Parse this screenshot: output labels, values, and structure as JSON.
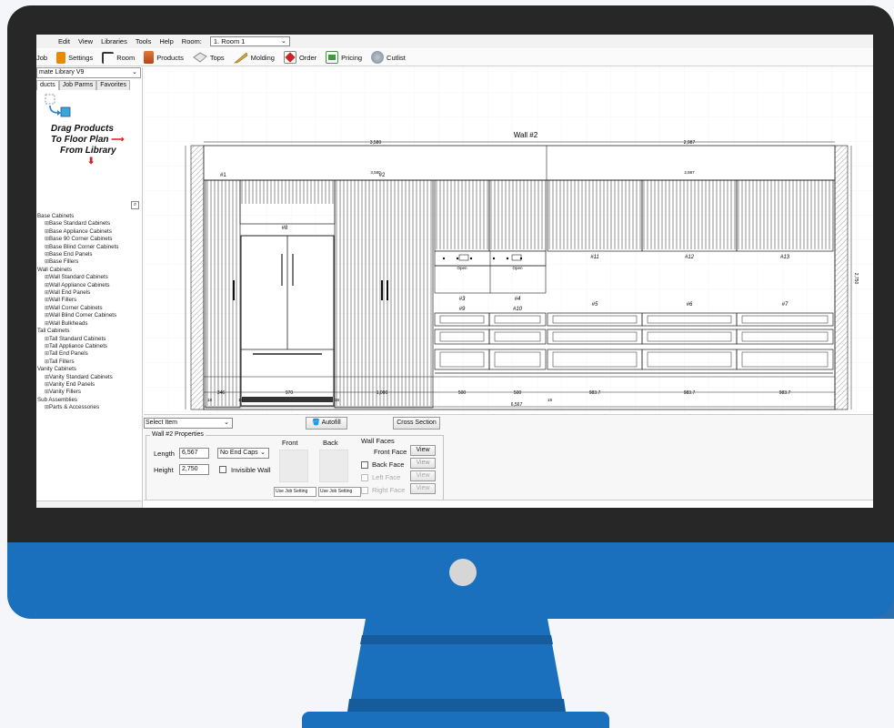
{
  "menu": {
    "items": [
      "Edit",
      "View",
      "Libraries",
      "Tools",
      "Help"
    ],
    "room_label": "Room:",
    "room_value": "1. Room 1"
  },
  "toolbar": {
    "items": [
      {
        "label": "Job",
        "icon": "job-icon",
        "color": "#333333"
      },
      {
        "label": "Settings",
        "icon": "settings-icon",
        "color": "#e68a00"
      },
      {
        "label": "Room",
        "icon": "room-icon",
        "color": "#444444"
      },
      {
        "label": "Products",
        "icon": "products-icon",
        "color": "#c9501c"
      },
      {
        "label": "Tops",
        "icon": "tops-icon",
        "color": "#9aa0a6"
      },
      {
        "label": "Molding",
        "icon": "molding-icon",
        "color": "#c49a2a"
      },
      {
        "label": "Order",
        "icon": "order-icon",
        "color": "#cc2222"
      },
      {
        "label": "Pricing",
        "icon": "pricing-icon",
        "color": "#3f9a3f"
      },
      {
        "label": "Cutlist",
        "icon": "cutlist-icon",
        "color": "#7a8a9a"
      }
    ]
  },
  "library": {
    "select_value": "mate Library V9",
    "tabs": [
      "ducts",
      "Job Parms",
      "Favorites"
    ],
    "drag_lines": [
      "Drag Products",
      "To Floor Plan",
      "From Library"
    ],
    "tree": [
      {
        "label": "Base Cabinets",
        "level": 0
      },
      {
        "label": "Base Standard Cabinets",
        "level": 1
      },
      {
        "label": "Base Appliance Cabinets",
        "level": 1
      },
      {
        "label": "Base 90 Corner Cabinets",
        "level": 1
      },
      {
        "label": "Base Blind Corner Cabinets",
        "level": 1
      },
      {
        "label": "Base End Panels",
        "level": 1
      },
      {
        "label": "Base Fillers",
        "level": 1
      },
      {
        "label": "Wall Cabinets",
        "level": 0
      },
      {
        "label": "Wall Standard Cabinets",
        "level": 1
      },
      {
        "label": "Wall Appliance Cabinets",
        "level": 1
      },
      {
        "label": "Wall End Panels",
        "level": 1
      },
      {
        "label": "Wall Fillers",
        "level": 1
      },
      {
        "label": "Wall Corner Cabinets",
        "level": 1
      },
      {
        "label": "Wall Blind Corner Cabinets",
        "level": 1
      },
      {
        "label": "Wall Bulkheads",
        "level": 1
      },
      {
        "label": "Tall Cabinets",
        "level": 0
      },
      {
        "label": "Tall Standard Cabinets",
        "level": 1
      },
      {
        "label": "Tall Appliance Cabinets",
        "level": 1
      },
      {
        "label": "Tall End Panels",
        "level": 1
      },
      {
        "label": "Tall Fillers",
        "level": 1
      },
      {
        "label": "Vanity Cabinets",
        "level": 0
      },
      {
        "label": "Vanity Standard Cabinets",
        "level": 1
      },
      {
        "label": "Vanity End Panels",
        "level": 1
      },
      {
        "label": "Vanity Fillers",
        "level": 1
      },
      {
        "label": "Sub Assemblies",
        "level": 0
      },
      {
        "label": "Parts & Accessories",
        "level": 1
      }
    ]
  },
  "drawing": {
    "wall_title": "Wall #2",
    "top_dims": [
      "3,580",
      "2,987"
    ],
    "sub_dims": [
      "3,580",
      "2,987"
    ],
    "labels": {
      "n1": "#1",
      "n2": "#2",
      "n3": "#3",
      "n4": "#4",
      "n5": "#5",
      "n6": "#6",
      "n7": "#7",
      "n8": "#8",
      "n9": "#9",
      "n10": "#10",
      "n11": "#11",
      "n12": "#12",
      "n13": "#13"
    },
    "open_label": "Open",
    "bottom_dims": [
      "346",
      "970",
      "1,000",
      "500",
      "500",
      "983.7",
      "983.7",
      "983.7"
    ],
    "small_dims": [
      "18",
      "18",
      "18",
      "18"
    ],
    "total_dim": "6,567",
    "right_dim": "2,750"
  },
  "bottom": {
    "select_item": "Select Item",
    "autofill": "Autofill",
    "cross_section": "Cross Section",
    "props_title": "Wall #2 Properties",
    "length_label": "Length",
    "length_value": "6,567",
    "height_label": "Height",
    "height_value": "2,750",
    "endcaps_value": "No End Caps",
    "invisible_label": "Invisible Wall",
    "front_label": "Front",
    "back_label": "Back",
    "use_job_front": "Use Job Setting",
    "use_job_back": "Use Job Setting",
    "faces_title": "Wall Faces",
    "front_face": "Front Face",
    "back_face": "Back Face",
    "left_face": "Left Face",
    "right_face": "Right Face",
    "view": "View"
  }
}
